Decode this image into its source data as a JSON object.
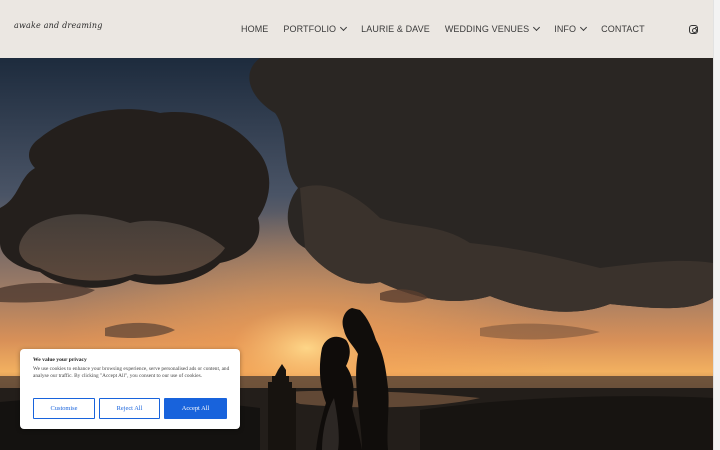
{
  "logo": {
    "text": "awake and dreaming"
  },
  "nav": {
    "items": [
      {
        "label": "HOME",
        "dropdown": false
      },
      {
        "label": "PORTFOLIO",
        "dropdown": true
      },
      {
        "label": "LAURIE & DAVE",
        "dropdown": false
      },
      {
        "label": "WEDDING VENUES",
        "dropdown": true
      },
      {
        "label": "INFO",
        "dropdown": true
      },
      {
        "label": "CONTACT",
        "dropdown": false
      }
    ],
    "social_icon": "instagram-icon"
  },
  "hero": {
    "image": "couple-silhouette-sunset-castle-photo"
  },
  "cookie_banner": {
    "title": "We value your privacy",
    "text": "We use cookies to enhance your browsing experience, serve personalised ads or content, and analyse our traffic. By clicking \"Accept All\", you consent to our use of cookies.",
    "buttons": {
      "customise": "Customise",
      "reject": "Reject All",
      "accept": "Accept All"
    }
  },
  "colors": {
    "header_bg": "#ebe7e2",
    "accent": "#1863dc",
    "nav_text": "#3b3b3b"
  }
}
